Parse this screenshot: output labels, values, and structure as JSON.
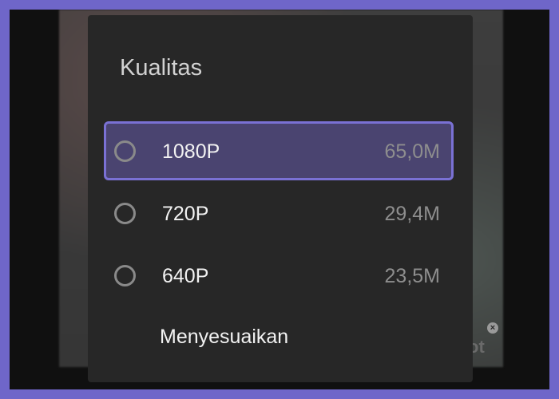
{
  "dialog": {
    "title": "Kualitas",
    "options": [
      {
        "label": "1080P",
        "size": "65,0M",
        "selected": true
      },
      {
        "label": "720P",
        "size": "29,4M",
        "selected": false
      },
      {
        "label": "640P",
        "size": "23,5M",
        "selected": false
      }
    ],
    "custom_label": "Menyesuaikan"
  },
  "colors": {
    "accent": "#7a71d4",
    "selected_background": "#4a4470",
    "dialog_background": "#272727",
    "frame_border": "#6f66c9"
  },
  "icons": {
    "radio": "radio-unchecked-icon",
    "backdrop_close": "close-icon"
  }
}
